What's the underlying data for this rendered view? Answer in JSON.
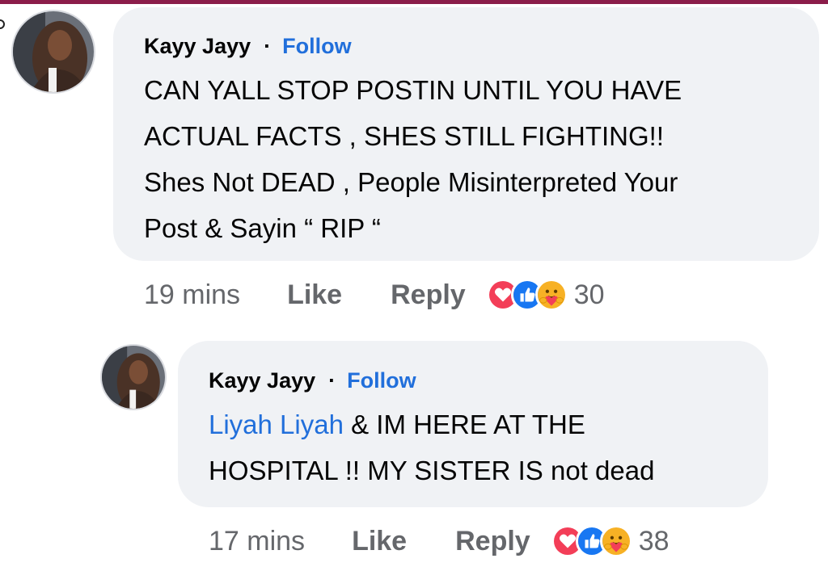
{
  "comments": [
    {
      "author": "Kayy Jayy",
      "separator": "·",
      "follow_label": "Follow",
      "lines": [
        "CAN YALL STOP POSTIN UNTIL YOU HAVE",
        "ACTUAL FACTS , SHES STILL FIGHTING!!",
        "Shes Not DEAD , People Misinterpreted Your",
        "Post & Sayin “ RIP “"
      ],
      "time": "19 mins",
      "like_label": "Like",
      "reply_label": "Reply",
      "reactions": [
        "love-icon",
        "like-icon",
        "care-icon"
      ],
      "reaction_count": "30"
    },
    {
      "author": "Kayy Jayy",
      "separator": "·",
      "follow_label": "Follow",
      "mention": "Liyah Liyah",
      "lines": [
        " & IM HERE AT THE",
        "HOSPITAL !! MY SISTER IS not dead"
      ],
      "time": "17 mins",
      "like_label": "Like",
      "reply_label": "Reply",
      "reactions": [
        "love-icon",
        "like-icon",
        "care-icon"
      ],
      "reaction_count": "38"
    }
  ],
  "colors": {
    "accent": "#216fdb",
    "bubble": "#f0f2f5",
    "meta": "#65676b",
    "top_bar": "#8b1d4a",
    "love": "#f33e58",
    "like": "#1877f2",
    "care": "#f7b125"
  }
}
